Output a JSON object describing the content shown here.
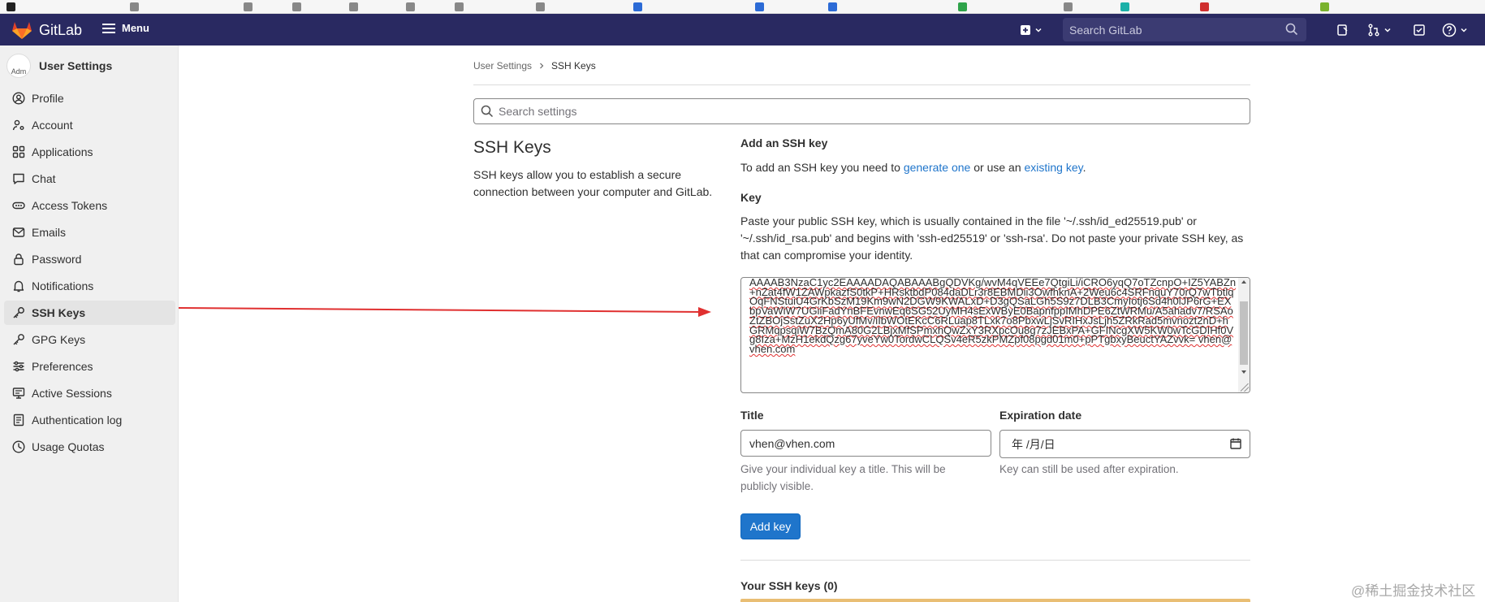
{
  "navbar": {
    "brand": "GitLab",
    "menu_label": "Menu",
    "search_placeholder": "Search GitLab"
  },
  "sidebar": {
    "avatar_alt": "Adm",
    "title": "User Settings",
    "items": [
      {
        "label": "Profile",
        "icon": "user-circle-icon"
      },
      {
        "label": "Account",
        "icon": "user-gear-icon"
      },
      {
        "label": "Applications",
        "icon": "grid-icon"
      },
      {
        "label": "Chat",
        "icon": "chat-icon"
      },
      {
        "label": "Access Tokens",
        "icon": "token-icon"
      },
      {
        "label": "Emails",
        "icon": "mail-icon"
      },
      {
        "label": "Password",
        "icon": "lock-icon"
      },
      {
        "label": "Notifications",
        "icon": "bell-icon"
      },
      {
        "label": "SSH Keys",
        "icon": "key-icon",
        "active": true
      },
      {
        "label": "GPG Keys",
        "icon": "key-icon"
      },
      {
        "label": "Preferences",
        "icon": "preferences-icon"
      },
      {
        "label": "Active Sessions",
        "icon": "monitor-icon"
      },
      {
        "label": "Authentication log",
        "icon": "log-icon"
      },
      {
        "label": "Usage Quotas",
        "icon": "quota-icon"
      }
    ]
  },
  "breadcrumb": {
    "parent": "User Settings",
    "current": "SSH Keys"
  },
  "settings_search": {
    "placeholder": "Search settings"
  },
  "section": {
    "title": "SSH Keys",
    "description": "SSH keys allow you to establish a secure connection between your computer and GitLab."
  },
  "form": {
    "add_heading": "Add an SSH key",
    "add_desc_prefix": "To add an SSH key you need to ",
    "add_desc_link1": "generate one",
    "add_desc_middle": " or use an ",
    "add_desc_link2": "existing key",
    "add_desc_suffix": ".",
    "key_label": "Key",
    "key_help": "Paste your public SSH key, which is usually contained in the file '~/.ssh/id_ed25519.pub' or '~/.ssh/id_rsa.pub' and begins with 'ssh-ed25519' or 'ssh-rsa'. Do not paste your private SSH key, as that can compromise your identity.",
    "key_value": "AAAAB3NzaC1yc2EAAAADAQABAAABgQDVKg/wvM4qVEEe7QtgiLi/iCRO6yqQ7oTZcnpO+IZ5YABZn+nZat4fW1ZAWpkazfS0tkP+HRsktbdP084daDLr3r8EBMDii3OwfhknA+2Weu6c4SRFnquY70rQ7wTbtlqOqFNStuiU4GrKbSzM19Km9wN2DGW9KWALxD+D3gQSaLGh5S9z7DLB3CmyIotj6Sd4h0lJP6rG+EXbpVaWiW7UGiiFadYnBFEvnwEq6SG52UyMH4sExWByE0BapnfppIMhDPE6ZtWRMu/A5ahadv7/RSAoZtZBOjSstZuX2Hp6yUfMv/iIbWOtEKcC6RLuap8TLxk7o8PbxwLjSvRIHxJsLjh5ZRkRad5mvnozt2nD+hGRMqpsqiW7BzQmA80G2LBjxMfSPmxhQwZxY3RXpcOu8g7zJEBxPA+GFINcgXW5KW0wTcGDIHf0Vg8Iza+MzH1ekdQzg67yveYw0TordwCLQSv4eR5zkPMZpf08pgd01m0+pPTgbxyBeuctYAZvvk= vhen@vhen.com",
    "title_label": "Title",
    "title_value": "vhen@vhen.com",
    "title_help": "Give your individual key a title. This will be publicly visible.",
    "expiration_label": "Expiration date",
    "expiration_placeholder": "年 /月/日",
    "expiration_help": "Key can still be used after expiration.",
    "add_button": "Add key"
  },
  "keys_list": {
    "heading": "Your SSH keys (0)"
  },
  "watermark": "@稀土掘金技术社区",
  "colors": {
    "navbar": "#292961",
    "primary": "#1f75cb",
    "arrow": "#e03030"
  }
}
